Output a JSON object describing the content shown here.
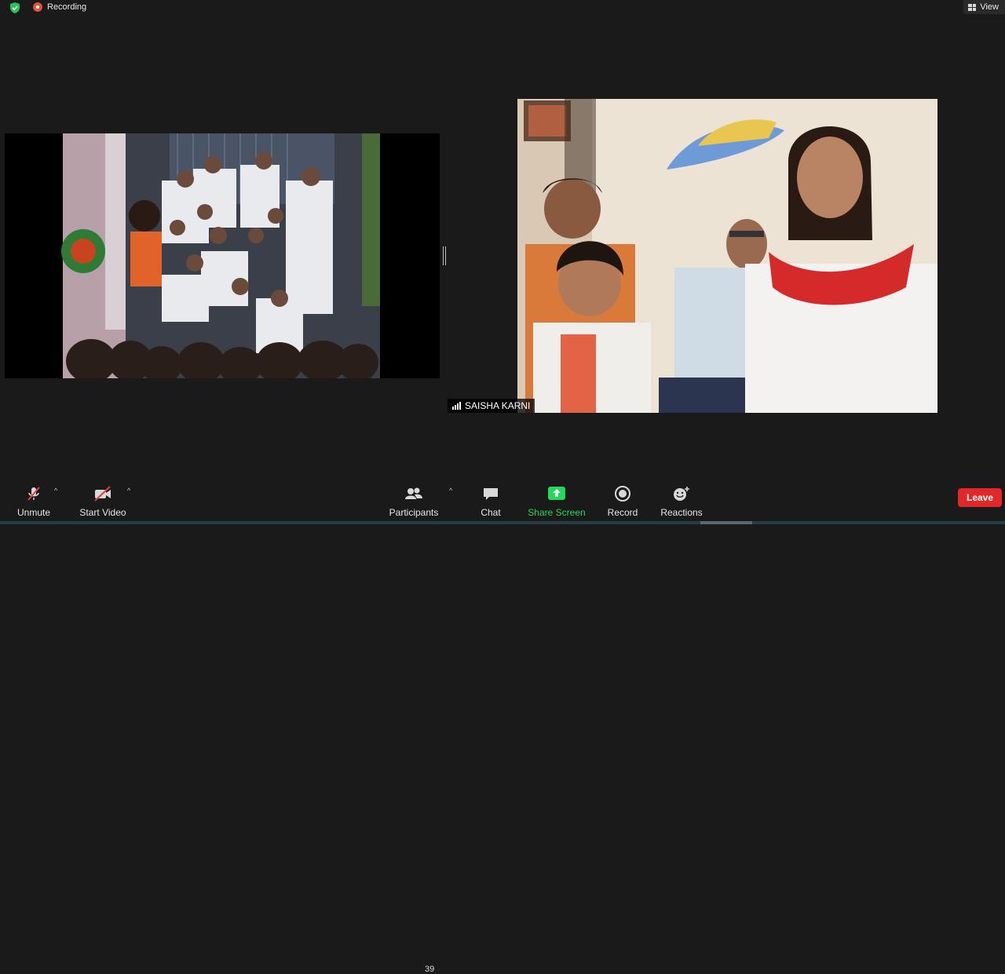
{
  "topbar": {
    "recording_label": "Recording",
    "view_label": "View",
    "security_icon": "shield-check-icon",
    "recording_icon": "record-dot-icon",
    "view_icon": "grid-view-icon"
  },
  "videos": {
    "left_tile": "shared-video-feed",
    "right_tile": "participant-video-feed",
    "participant_name": "SAISHA KARNI"
  },
  "toolbar": {
    "unmute_label": "Unmute",
    "start_video_label": "Start Video",
    "participants_label": "Participants",
    "participants_count": "39",
    "chat_label": "Chat",
    "share_screen_label": "Share Screen",
    "record_label": "Record",
    "reactions_label": "Reactions",
    "leave_label": "Leave",
    "caret": "^"
  },
  "colors": {
    "background": "#1a1a1a",
    "share_green": "#23d959",
    "leave_red": "#e02828",
    "muted_red": "#e0533d"
  }
}
